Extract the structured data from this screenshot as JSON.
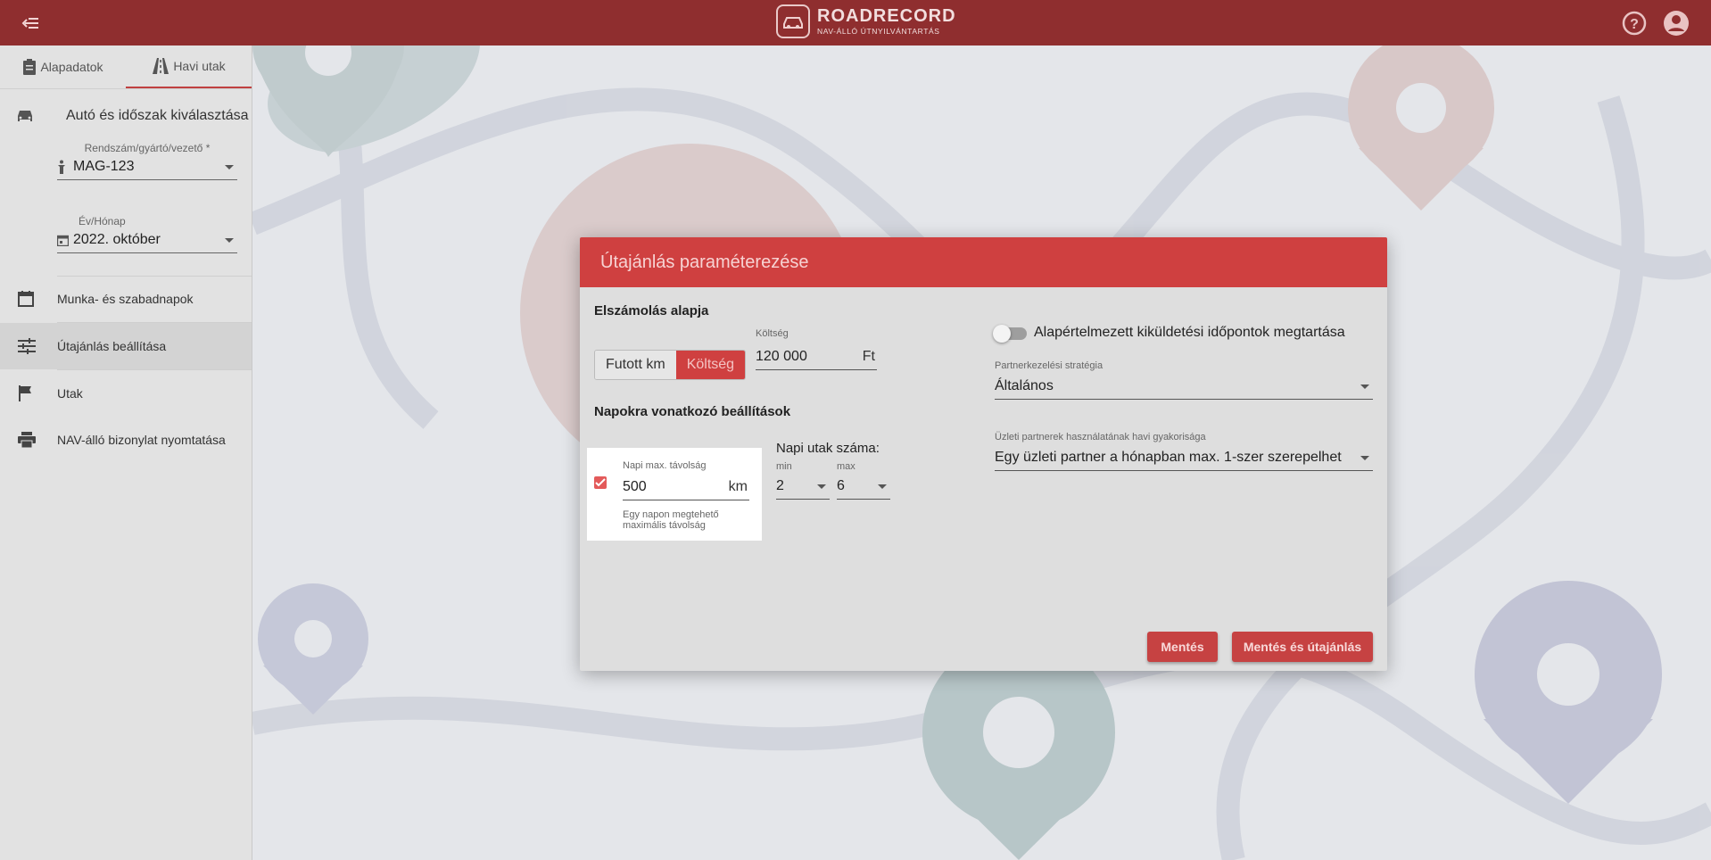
{
  "app": {
    "logo_title": "ROADRECORD",
    "logo_subtitle": "NAV-ÁLLÓ ÚTNYILVÁNTARTÁS",
    "colors": {
      "header": "#8f2e2f",
      "accent": "#cf4040"
    }
  },
  "sidebar": {
    "tabs": [
      {
        "label": "Alapadatok",
        "icon": "clipboard-icon"
      },
      {
        "label": "Havi utak",
        "icon": "road-icon"
      }
    ],
    "section_title": "Autó és időszak kiválasztása",
    "vehicle_field": {
      "label": "Rendszám/gyártó/vezető *",
      "value": "MAG-123"
    },
    "period_field": {
      "label": "Év/Hónap",
      "value": "2022. október"
    },
    "nav": [
      {
        "label": "Munka- és szabadnapok",
        "icon": "calendar-icon"
      },
      {
        "label": "Útajánlás beállítása",
        "icon": "sliders-icon"
      },
      {
        "label": "Utak",
        "icon": "flag-icon"
      },
      {
        "label": "NAV-álló bizonylat nyomtatása",
        "icon": "printer-icon"
      }
    ]
  },
  "dialog": {
    "title": "Útajánlás paraméterezése",
    "billing_title": "Elszámolás alapja",
    "segment": {
      "option_km": "Futott km",
      "option_cost": "Költség"
    },
    "cost_field": {
      "label": "Költség",
      "value": "120 000",
      "unit": "Ft"
    },
    "daily_title": "Napokra vonatkozó beállítások",
    "max_distance": {
      "label": "Napi max. távolság",
      "value": "500",
      "unit": "km",
      "hint_line1": "Egy napon megtehető",
      "hint_line2": "maximális távolság",
      "checked": true
    },
    "trips_count": {
      "label": "Napi utak száma:",
      "min_label": "min",
      "min_value": "2",
      "max_label": "max",
      "max_value": "6"
    },
    "toggle_label": "Alapértelmezett kiküldetési időpontok megtartása",
    "partner_strategy": {
      "label": "Partnerkezelési stratégia",
      "value": "Általános"
    },
    "partner_frequency": {
      "label": "Üzleti partnerek használatának havi gyakorisága",
      "value": "Egy üzleti partner a hónapban max. 1-szer szerepelhet"
    },
    "buttons": {
      "save": "Mentés",
      "save_recommend": "Mentés és útajánlás"
    }
  }
}
